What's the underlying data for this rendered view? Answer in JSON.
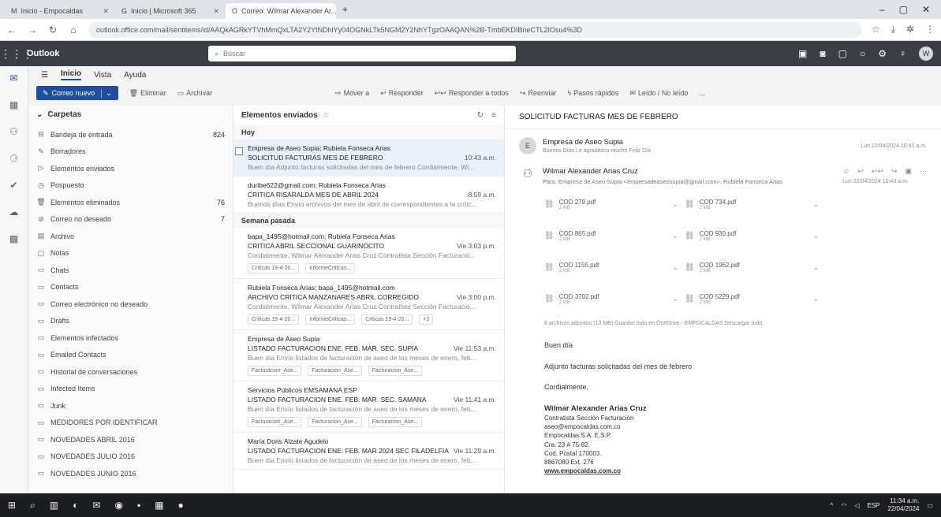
{
  "browser": {
    "tabs": [
      {
        "icon": "M",
        "label": "Inicio - Empocaldas"
      },
      {
        "icon": "G",
        "label": "Inicio | Microsoft 365"
      },
      {
        "icon": "O",
        "label": "Correo: Wilmar Alexander Ar..."
      }
    ],
    "url": "outlook.office.com/mail/sentitems/id/AAQkAGRkYTVhMmQxLTA2Y2YtNDhlYy04OGNkLTk5NGM2Y2NhYTgzOAAQAN%2B-TmbEKDIBneCTL2IOsu4%3D"
  },
  "app": {
    "name": "Outlook",
    "search_placeholder": "Buscar"
  },
  "menu": {
    "tabs": [
      "Inicio",
      "Vista",
      "Ayuda"
    ]
  },
  "toolbar": {
    "new_mail": "Correo nuevo",
    "delete": "Eliminar",
    "archive": "Archivar",
    "move": "Mover a",
    "reply": "Responder",
    "reply_all": "Responder a todos",
    "forward": "Reenviar",
    "quick_steps": "Pasos rápidos",
    "read_unread": "Leído / No leído",
    "more": "..."
  },
  "folders": {
    "title": "Carpetas",
    "items": [
      {
        "label": "Bandeja de entrada",
        "count": "824",
        "icon": "inbox-icon"
      },
      {
        "label": "Borradores",
        "count": "",
        "icon": "drafts-icon"
      },
      {
        "label": "Elementos enviados",
        "count": "",
        "icon": "sent-icon"
      },
      {
        "label": "Pospuesto",
        "count": "",
        "icon": "clock-icon"
      },
      {
        "label": "Elementos eliminados",
        "count": "76",
        "icon": "trash-icon"
      },
      {
        "label": "Correo no deseado",
        "count": "7",
        "icon": "junk-icon"
      },
      {
        "label": "Archivo",
        "count": "",
        "icon": "archive-icon"
      },
      {
        "label": "Notas",
        "count": "",
        "icon": "notes-icon"
      },
      {
        "label": "Chats",
        "count": "",
        "icon": "folder-icon"
      },
      {
        "label": "Contacts",
        "count": "",
        "icon": "folder-icon"
      },
      {
        "label": "Correo electrónico no deseado",
        "count": "",
        "icon": "folder-icon"
      },
      {
        "label": "Drafts",
        "count": "",
        "icon": "folder-icon"
      },
      {
        "label": "Elementos infectados",
        "count": "",
        "icon": "folder-icon"
      },
      {
        "label": "Emailed Contacts",
        "count": "",
        "icon": "folder-icon"
      },
      {
        "label": "Historial de conversaciones",
        "count": "",
        "icon": "folder-icon"
      },
      {
        "label": "Infected Items",
        "count": "",
        "icon": "folder-icon"
      },
      {
        "label": "Junk",
        "count": "",
        "icon": "folder-icon"
      },
      {
        "label": "MEDIDORES POR IDENTIFICAR",
        "count": "",
        "icon": "folder-icon"
      },
      {
        "label": "NOVEDADES ABRIL 2016",
        "count": "",
        "icon": "folder-icon"
      },
      {
        "label": "NOVEDADES JULIO 2016",
        "count": "",
        "icon": "folder-icon"
      },
      {
        "label": "NOVEDADES JUNIO 2016",
        "count": "",
        "icon": "folder-icon"
      }
    ]
  },
  "list": {
    "title": "Elementos enviados",
    "groups": [
      {
        "label": "Hoy",
        "messages": [
          {
            "from": "Empresa de Aseo Supia; Rubiela Fonseca Arias",
            "subject": "SOLICITUD FACTURAS MES DE FEBRERO",
            "time": "10:43 a.m.",
            "preview": "Buen día Adjunto facturas solicitadas del mes de febrero Cordialmente, Wi...",
            "chips": []
          },
          {
            "from": "duribe622@gmail.com; Rubiela Fonseca Arias",
            "subject": "CRITICA RISARALDA MES DE ABRIL 2024",
            "time": "8:59 a.m.",
            "preview": "Buenos días Envío archivos del mes de abril de correspondientes a la crític...",
            "chips": []
          }
        ]
      },
      {
        "label": "Semana pasada",
        "messages": [
          {
            "from": "bapa_1495@hotmail.com; Rubiela Fonseca Arias",
            "subject": "CRITICA ABRIL SECCIONAL GUARINOCITO",
            "time": "Vie 3:03 p.m.",
            "preview": "Cordialmente, Wilmar Alexander Arias Cruz Contratista Sección Facturació...",
            "chips": [
              "Criticas 19-4-20...",
              "InformeCriticas..."
            ]
          },
          {
            "from": "Rubiela Fonseca Arias; bapa_1495@hotmail.com",
            "subject": "ARCHIVO CRITICA MANZANARES ABRIL CORREGIDO",
            "time": "Vie 3:00 p.m.",
            "preview": "Cordialmente, Wilmar Alexander Arias Cruz Contratista Sección Facturació...",
            "chips": [
              "Criticas 19-4-20...",
              "InformeCriticas...",
              "Criticas 19-4-20...",
              "+2"
            ]
          },
          {
            "from": "Empresa de Aseo Supia",
            "subject": "LISTADO FACTURACION ENE. FEB. MAR. SEC. SUPIA",
            "time": "Vie 11:53 a.m.",
            "preview": "Buen día Envío listados de facturación de aseo de los meses de enero, feb...",
            "chips": [
              "Facturacion_Ase...",
              "Facturacion_Ase...",
              "Facturacion_Ase..."
            ]
          },
          {
            "from": "Servicios Públicos EMSAMANA ESP",
            "subject": "LISTADO FACTURACION ENE. FEB. MAR. SEC. SAMANA",
            "time": "Vie 11:41 a.m.",
            "preview": "Buen día Envío listados de facturación de aseo de los meses de enero, feb...",
            "chips": [
              "Facturacion_Ase...",
              "Facturacion_Ase...",
              "Facturacion_Ase..."
            ]
          },
          {
            "from": "María Doris Alzate Agudelo",
            "subject": "LISTADO FACTURACION ENE. FEB. MAR 2024 SEC FILADELFIA",
            "time": "Vie 11:29 a.m.",
            "preview": "Buen día Envío listados de facturación de aseo de los meses de enero, feb...",
            "chips": []
          }
        ]
      }
    ]
  },
  "reading": {
    "subject": "SOLICITUD FACTURAS MES DE FEBRERO",
    "first": {
      "initial": "E",
      "name": "Empresa de Aseo Supia",
      "snippet": "Buenos Días Le agradezco mucho Feliz Día",
      "date": "Lun 22/04/2024 10:41 a.m."
    },
    "second": {
      "name": "Wilmar Alexander Arias Cruz",
      "to": "Para: Empresa de Aseo Supia <empresadeaseosupia@gmail.com>; Rubiela Fonseca Arias",
      "date": "Lun 22/04/2024 10:43 a.m."
    },
    "attachments": [
      {
        "name": "COD 279.pdf",
        "size": "2 MB"
      },
      {
        "name": "COD 734.pdf",
        "size": "2 MB"
      },
      {
        "name": "COD 865.pdf",
        "size": "2 MB"
      },
      {
        "name": "COD 930.pdf",
        "size": "2 MB"
      },
      {
        "name": "COD 1155.pdf",
        "size": "2 MB"
      },
      {
        "name": "COD 1962.pdf",
        "size": "2 MB"
      },
      {
        "name": "COD 3702.pdf",
        "size": "2 MB"
      },
      {
        "name": "COD 5229.pdf",
        "size": "2 MB"
      }
    ],
    "attachment_summary": "8 archivos adjuntos (13 MB)   Guardar todo en OneDrive - EMPOCALDAS   Descargar todo",
    "greeting": "Buen día",
    "body": "Adjunto facturas solicitadas del mes de febrero",
    "closing": "Cordialmente,",
    "signature": {
      "name": "Wilmar Alexander Arias Cruz",
      "lines": [
        "Contratista Sección Facturación",
        "aseo@empocaldas.com.co",
        "Empocaldas S.A. E.S.P.",
        "Cra. 23 # 75-82.",
        "Cod. Postal 170003.",
        "8867080 Ext. 276"
      ],
      "link": "www.empocaldas.com.co"
    }
  },
  "taskbar": {
    "lang": "ESP",
    "time": "11:34 a.m.",
    "date": "22/04/2024"
  }
}
